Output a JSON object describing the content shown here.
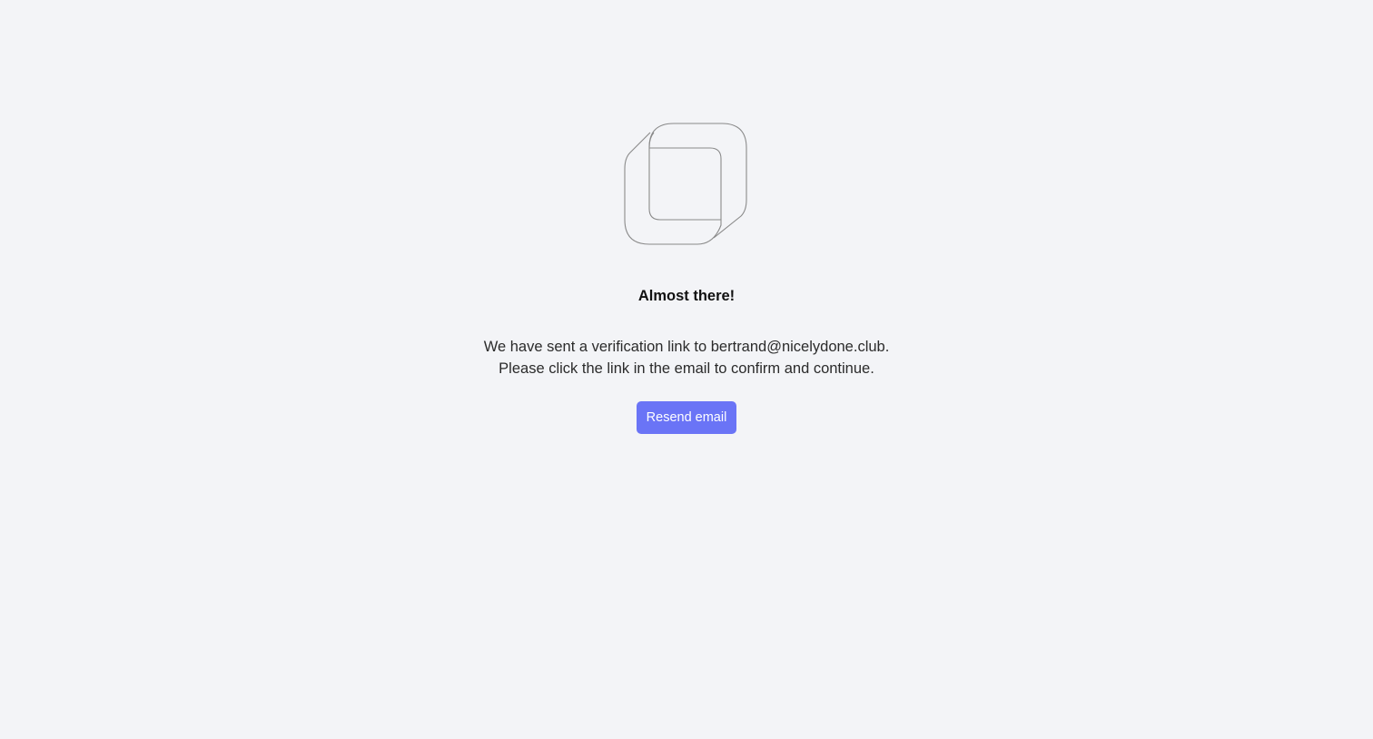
{
  "logo": {
    "icon": "nested-rounded-squares-logo-icon",
    "stroke_color": "#8a8a8a"
  },
  "heading": "Almost there!",
  "message": {
    "line1": "We have sent a verification link to bertrand@nicelydone.club.",
    "line2": "Please click the link in the email to confirm and continue."
  },
  "resend_button": {
    "label": "Resend email",
    "color": "#6a74f6"
  }
}
